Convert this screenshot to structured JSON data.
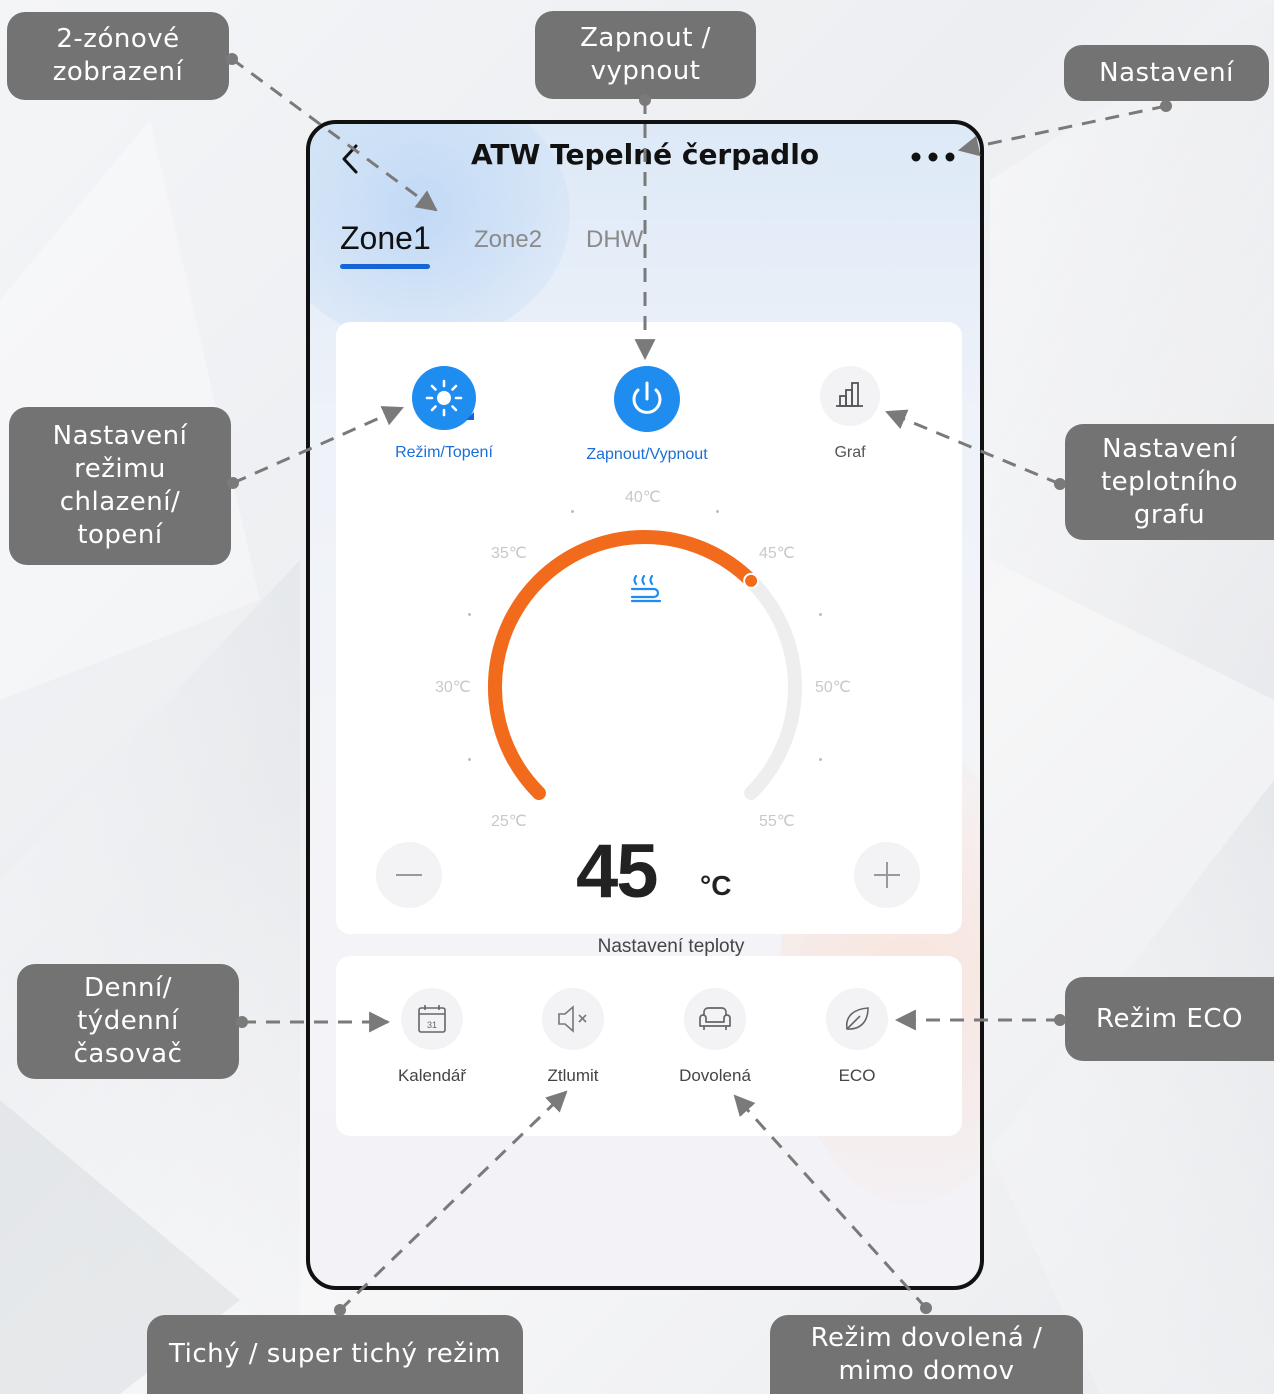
{
  "app": {
    "title": "ATW Tepelné čerpadlo",
    "tabs": [
      "Zone1",
      "Zone2",
      "DHW"
    ],
    "active_tab": "Zone1"
  },
  "controls": {
    "mode_label": "Režim/Topení",
    "power_label": "Zapnout/Vypnout",
    "graph_label": "Graf"
  },
  "thermostat": {
    "value": "45",
    "unit": "°C",
    "caption": "Nastavení teploty",
    "min": 25,
    "max": 55,
    "setpoint": 45,
    "scale_labels": [
      "25℃",
      "30℃",
      "35℃",
      "40℃",
      "45℃",
      "50℃",
      "55℃"
    ]
  },
  "functions": [
    "Kalendář",
    "Ztlumit",
    "Dovolená",
    "ECO"
  ],
  "annotations": {
    "zones": "2-zónové\nzobrazení",
    "power": "Zapnout /\nvypnout",
    "settings": "Nastavení",
    "mode": "Nastavení\nrežimu\nchlazení/\ntopení",
    "graph": "Nastavení\nteplotního\ngrafu",
    "timer": "Denní/\ntýdenní\nčasovač",
    "eco": "Režim ECO",
    "quiet": "Tichý / super tichý režim",
    "holiday": "Režim dovolená /\nmimo domov"
  },
  "colors": {
    "accent_blue": "#1f8cf0",
    "tab_underline": "#1565d8",
    "arc_orange": "#f26a1b",
    "label_bg": "#737373",
    "selected_text": "#1a6fd8"
  }
}
